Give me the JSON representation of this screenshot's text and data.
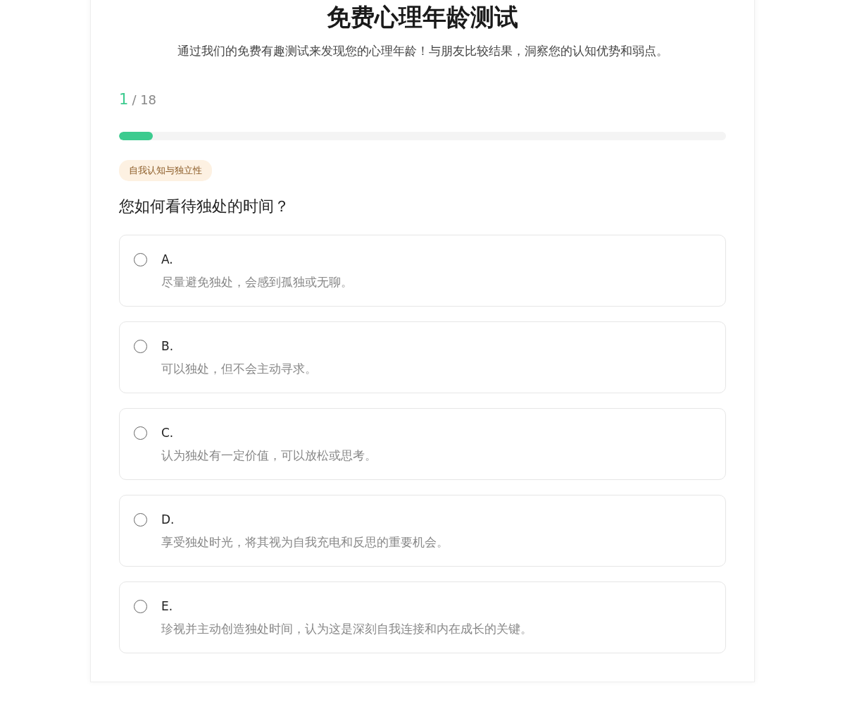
{
  "title": "免费心理年龄测试",
  "subtitle": "通过我们的免费有趣测试来发现您的心理年龄！与朋友比较结果，洞察您的认知优势和弱点。",
  "progress": {
    "current": "1",
    "total": "/ 18",
    "level": 0.056
  },
  "category": "自我认知与独立性",
  "question": "您如何看待独处的时间？",
  "options": [
    {
      "letter": "A.",
      "text": "尽量避免独处，会感到孤独或无聊。",
      "selected": false
    },
    {
      "letter": "B.",
      "text": "可以独处，但不会主动寻求。",
      "selected": false
    },
    {
      "letter": "C.",
      "text": "认为独处有一定价值，可以放松或思考。",
      "selected": false
    },
    {
      "letter": "D.",
      "text": "享受独处时光，将其视为自我充电和反思的重要机会。",
      "selected": false
    },
    {
      "letter": "E.",
      "text": "珍视并主动创造独处时间，认为这是深刻自我连接和内在成长的关键。",
      "selected": false
    }
  ]
}
